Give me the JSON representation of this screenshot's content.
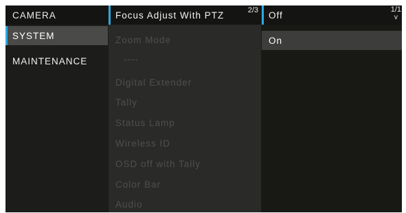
{
  "menu": {
    "categories": [
      {
        "label": "CAMERA"
      },
      {
        "label": "SYSTEM"
      },
      {
        "label": "MAINTENANCE"
      }
    ],
    "items": [
      {
        "label": "Focus Adjust With PTZ"
      },
      {
        "label": "Zoom Mode"
      },
      {
        "label": "----"
      },
      {
        "label": "Digital Extender"
      },
      {
        "label": "Tally"
      },
      {
        "label": "Status Lamp"
      },
      {
        "label": "Wireless ID"
      },
      {
        "label": "OSD off with Tally"
      },
      {
        "label": "Color Bar"
      },
      {
        "label": "Audio"
      }
    ],
    "items_page": "2/3",
    "options": [
      {
        "label": "Off"
      },
      {
        "label": "On"
      }
    ],
    "options_page": "1/1",
    "options_scroll_icon": "down-arrow-icon",
    "accent_color": "#2fa8e0"
  }
}
